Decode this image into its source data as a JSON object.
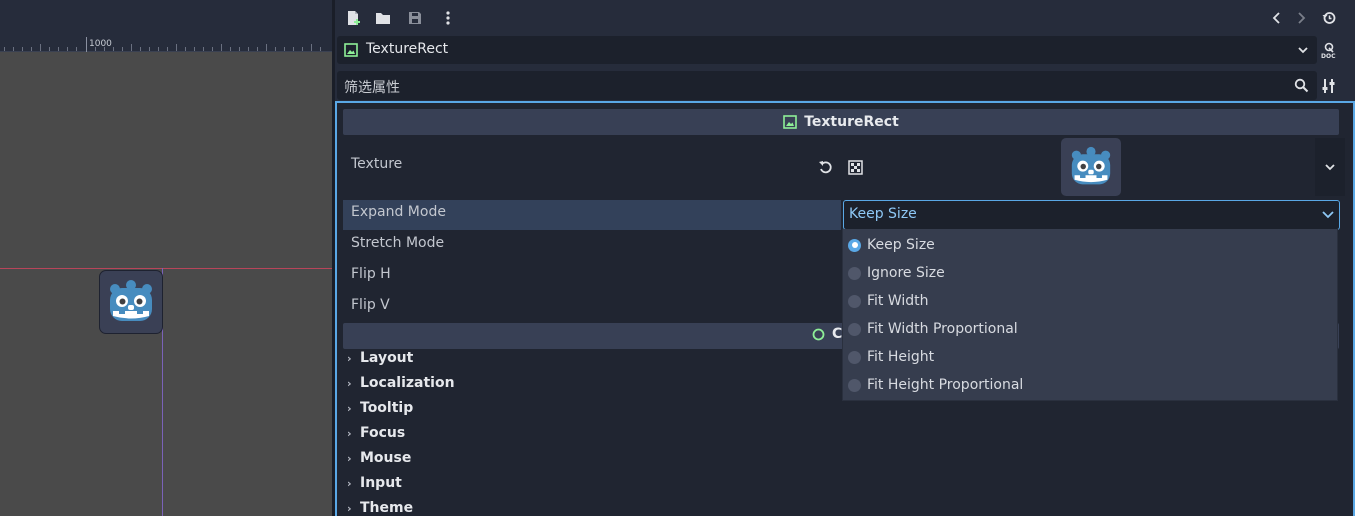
{
  "viewport": {
    "ruler_label": "1000"
  },
  "inspector": {
    "object_name": "TextureRect",
    "filter_placeholder": "筛选属性",
    "class_header": "TextureRect",
    "properties": {
      "texture": "Texture",
      "expand_mode": "Expand Mode",
      "stretch_mode": "Stretch Mode",
      "flip_h": "Flip H",
      "flip_v": "Flip V"
    },
    "control_header_visible": "Co",
    "sections": [
      "Layout",
      "Localization",
      "Tooltip",
      "Focus",
      "Mouse",
      "Input",
      "Theme"
    ]
  },
  "dropdown": {
    "selected": "Keep Size",
    "options": [
      "Keep Size",
      "Ignore Size",
      "Fit Width",
      "Fit Width Proportional",
      "Fit Height",
      "Fit Height Proportional"
    ],
    "selected_index": 0
  },
  "colors": {
    "accent": "#5aa8e6",
    "node_icon": "#8eef97",
    "godot_blue": "#478cbf"
  }
}
